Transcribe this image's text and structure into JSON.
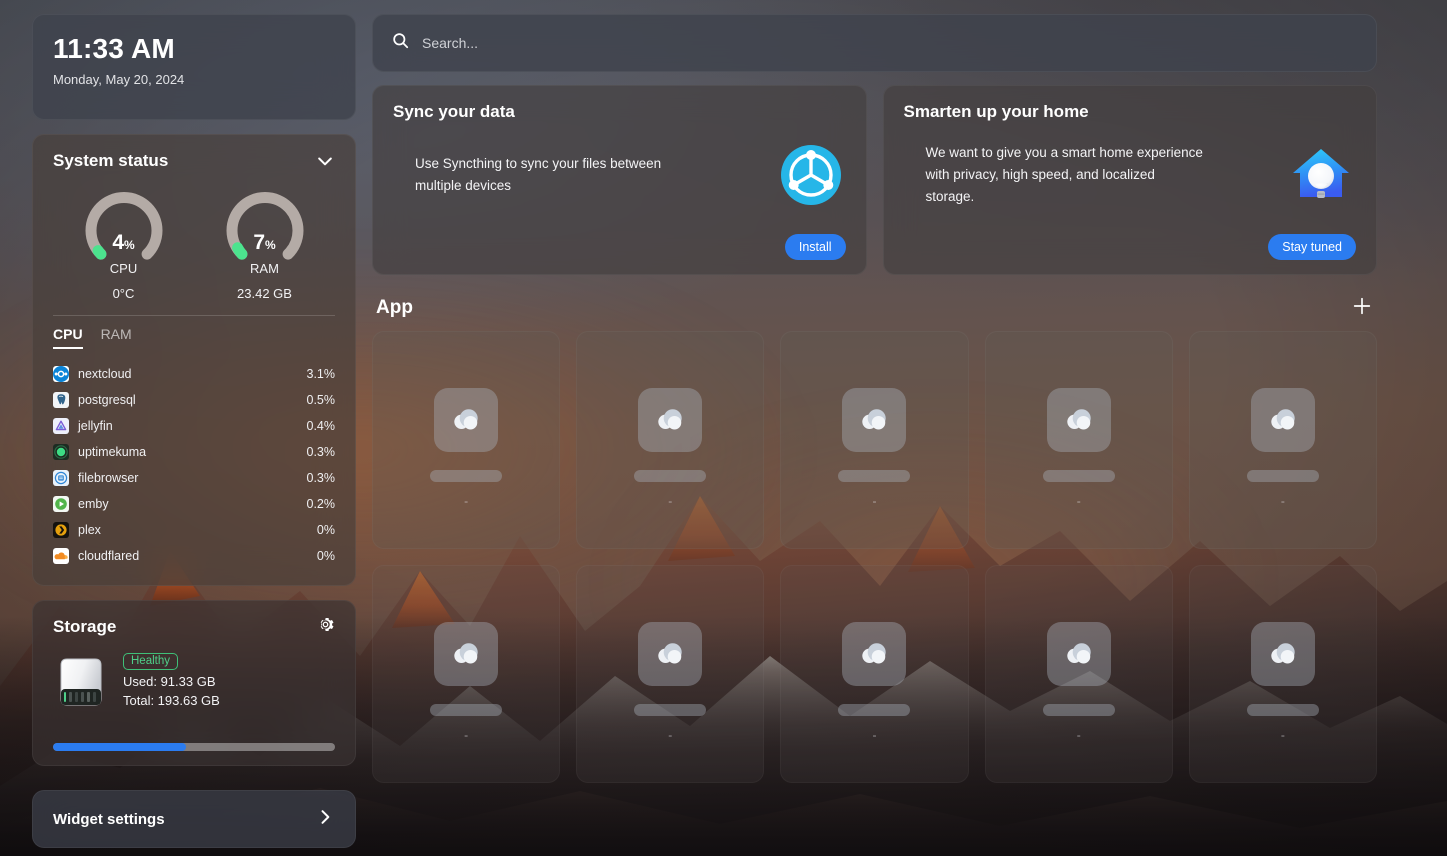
{
  "clock": {
    "time": "11:33 AM",
    "date": "Monday, May 20, 2024"
  },
  "system_status": {
    "title": "System status",
    "collapse_icon": "chevron-down-icon",
    "gauges": [
      {
        "id": "cpu",
        "value": "4",
        "unit": "%",
        "label": "CPU",
        "sub": "0°C",
        "percent": 4
      },
      {
        "id": "ram",
        "value": "7",
        "unit": "%",
        "label": "RAM",
        "sub": "23.42 GB",
        "percent": 7
      }
    ],
    "tabs": [
      {
        "label": "CPU",
        "active": true
      },
      {
        "label": "RAM",
        "active": false
      }
    ],
    "processes": [
      {
        "name": "nextcloud",
        "value": "3.1%",
        "icon": "nextcloud-icon",
        "color": "#0a84d8"
      },
      {
        "name": "postgresql",
        "value": "0.5%",
        "icon": "postgresql-icon",
        "color": "#f2f5f8"
      },
      {
        "name": "jellyfin",
        "value": "0.4%",
        "icon": "jellyfin-icon",
        "color": "#eef0fb"
      },
      {
        "name": "uptimekuma",
        "value": "0.3%",
        "icon": "uptimekuma-icon",
        "color": "#1d2b22"
      },
      {
        "name": "filebrowser",
        "value": "0.3%",
        "icon": "filebrowser-icon",
        "color": "#eaf2fb"
      },
      {
        "name": "emby",
        "value": "0.2%",
        "icon": "emby-icon",
        "color": "#f3f8f3"
      },
      {
        "name": "plex",
        "value": "0%",
        "icon": "plex-icon",
        "color": "#14120f"
      },
      {
        "name": "cloudflared",
        "value": "0%",
        "icon": "cloudflared-icon",
        "color": "#f28b22"
      }
    ]
  },
  "storage": {
    "title": "Storage",
    "settings_icon": "gear-icon",
    "badge": "Healthy",
    "used": "Used: 91.33 GB",
    "total": "Total: 193.63 GB",
    "used_percent": 47,
    "bar_color": "#2b7cf0"
  },
  "widget_settings": {
    "label": "Widget settings",
    "chevron_icon": "chevron-right-icon"
  },
  "search": {
    "placeholder": "Search...",
    "value": "",
    "icon": "search-icon"
  },
  "promos": [
    {
      "title": "Sync your data",
      "text": "Use Syncthing to sync your files between multiple devices",
      "button": "Install",
      "art": "syncthing-logo",
      "accent": "#2b7cf0"
    },
    {
      "title": "Smarten up your home",
      "text": "We want to give you a smart home experience with privacy, high speed, and localized storage.",
      "button": "Stay tuned",
      "art": "home-assistant-logo",
      "accent": "#2b7cf0"
    }
  ],
  "apps": {
    "title": "App",
    "add_icon": "plus-icon",
    "tiles": [
      {
        "placeholder": "-"
      },
      {
        "placeholder": "-"
      },
      {
        "placeholder": "-"
      },
      {
        "placeholder": "-"
      },
      {
        "placeholder": "-"
      },
      {
        "placeholder": "-"
      },
      {
        "placeholder": "-"
      },
      {
        "placeholder": "-"
      },
      {
        "placeholder": "-"
      },
      {
        "placeholder": "-"
      }
    ]
  }
}
